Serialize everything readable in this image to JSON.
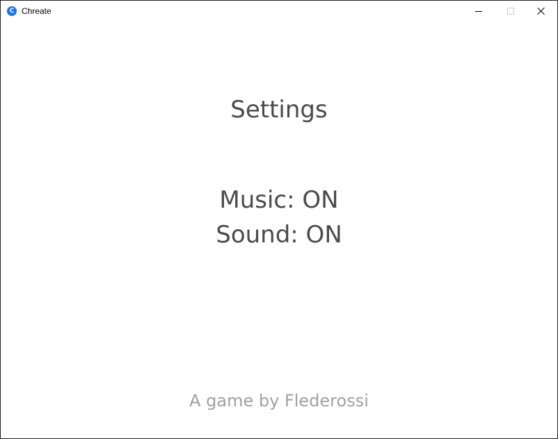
{
  "window": {
    "title": "Chreate",
    "icon_letter": "C",
    "icon_color": "#1a73e8"
  },
  "screen": {
    "title": "Settings",
    "music_label": "Music: ON",
    "sound_label": "Sound: ON",
    "credit": "A game by Flederossi"
  },
  "colors": {
    "text": "#4a4a4a",
    "credit": "#a0a0a0",
    "background": "#ffffff"
  }
}
